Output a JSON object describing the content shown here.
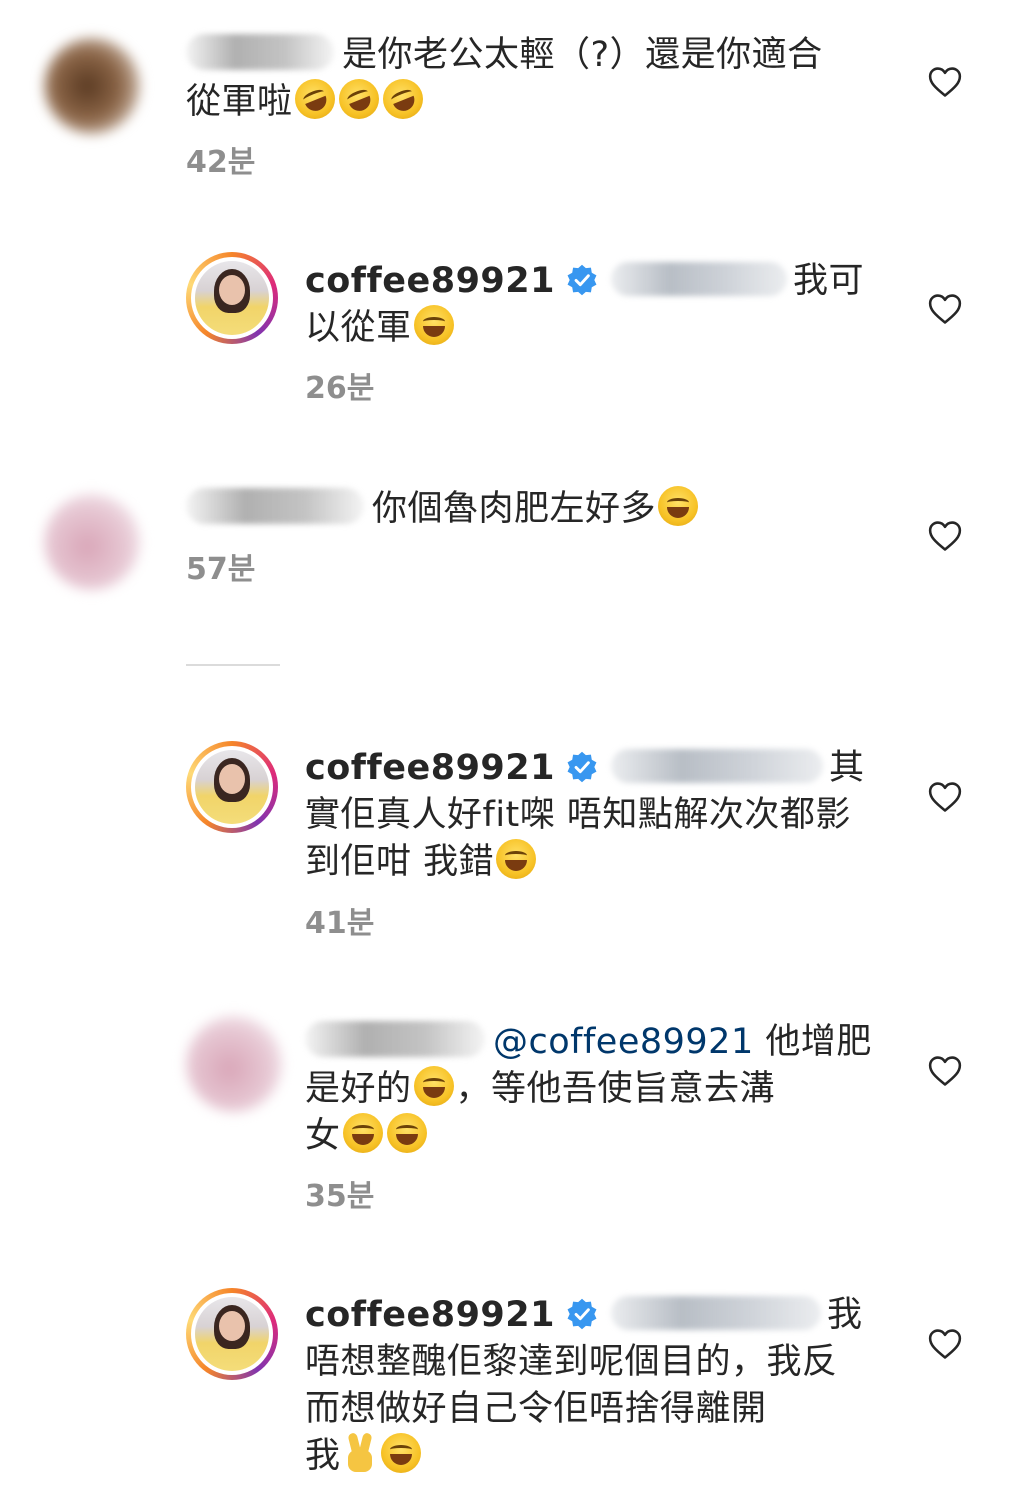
{
  "comments": [
    {
      "text_line1": "是你老公太輕（?）還是你適合",
      "text_line2": "從軍啦",
      "time": "42분"
    },
    {
      "username": "coffee89921",
      "text_after_mention": "我可",
      "text_line2": "以從軍",
      "time": "26분"
    },
    {
      "text_line1": "你個魯肉肥左好多",
      "time": "57분"
    },
    {
      "username": "coffee89921",
      "text_after_mention": "其",
      "text_line2": "實佢真人好fit㗎 唔知點解次次都影",
      "text_line3": "到佢咁 我錯",
      "time": "41분"
    },
    {
      "mention": "@coffee89921",
      "text_after_mention": "他增肥",
      "text_line2a": "是好的",
      "text_line2b": "，等他吾使旨意去溝",
      "text_line3": "女",
      "time": "35분"
    },
    {
      "username": "coffee89921",
      "text_after_mention": "我",
      "text_line2": "唔想整醜佢黎達到呢個目的，我反",
      "text_line3": "而想做好自己令佢唔捨得離開",
      "text_line4": "我",
      "time": ""
    }
  ],
  "icons": {
    "like": "heart-outline-icon",
    "verified": "verified-badge-icon",
    "emoji_rofl": "rolling-on-floor-laughing-emoji",
    "emoji_joy": "face-with-tears-of-joy-emoji",
    "emoji_peace": "victory-hand-emoji"
  },
  "colors": {
    "text": "#262626",
    "time": "#8e8e8e",
    "verified": "#3897f0",
    "mention": "#00376b",
    "divider": "#dbdbdb"
  }
}
